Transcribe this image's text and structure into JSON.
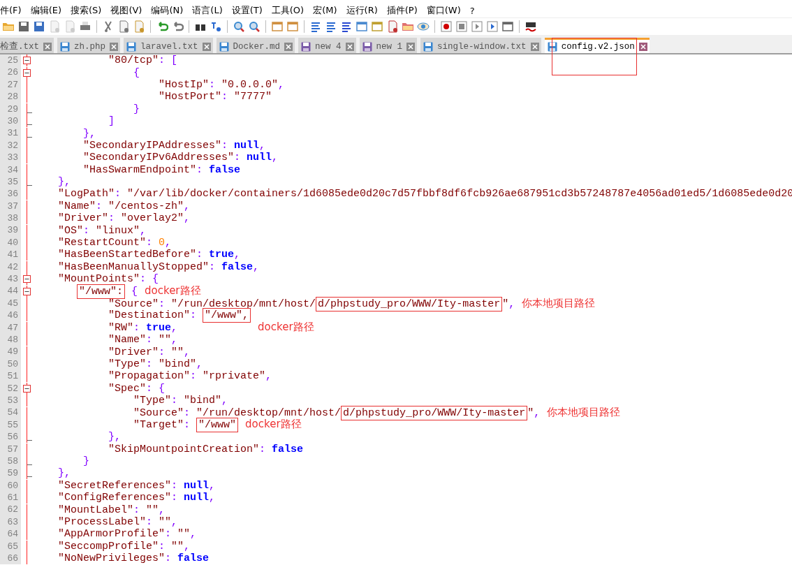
{
  "menu": [
    "件(F)",
    "编辑(E)",
    "搜索(S)",
    "视图(V)",
    "编码(N)",
    "语言(L)",
    "设置(T)",
    "工具(O)",
    "宏(M)",
    "运行(R)",
    "插件(P)",
    "窗口(W)",
    "?"
  ],
  "tabs": [
    {
      "label": "检查.txt",
      "selected": false,
      "annotated": false
    },
    {
      "label": "zh.php",
      "selected": false,
      "modified": false,
      "annotated": false
    },
    {
      "label": "laravel.txt",
      "selected": false,
      "modified": false,
      "annotated": false
    },
    {
      "label": "Docker.md",
      "selected": false,
      "modified": false,
      "annotated": false
    },
    {
      "label": "new 4",
      "selected": false,
      "modified": true,
      "annotated": false
    },
    {
      "label": "new 1",
      "selected": false,
      "modified": true,
      "annotated": false
    },
    {
      "label": "single-window.txt",
      "selected": false,
      "modified": false,
      "annotated": false
    },
    {
      "label": "config.v2.json",
      "selected": true,
      "modified": false,
      "annotated": true
    }
  ],
  "lines": [
    {
      "number": "25",
      "foldable": true,
      "block_end": false,
      "tokens": [
        {
          "kind": "str",
          "text": "            \"80/tcp\""
        },
        {
          "kind": "op",
          "text": ": ["
        }
      ]
    },
    {
      "number": "26",
      "foldable": true,
      "block_end": false,
      "tokens": [
        {
          "kind": "op",
          "text": "                {"
        }
      ]
    },
    {
      "number": "27",
      "foldable": false,
      "block_end": false,
      "tokens": [
        {
          "kind": "str",
          "text": "                    \"HostIp\""
        },
        {
          "kind": "op",
          "text": ": "
        },
        {
          "kind": "str",
          "text": "\"0.0.0.0\""
        },
        {
          "kind": "op",
          "text": ","
        }
      ]
    },
    {
      "number": "28",
      "foldable": false,
      "block_end": false,
      "tokens": [
        {
          "kind": "str",
          "text": "                    \"HostPort\""
        },
        {
          "kind": "op",
          "text": ": "
        },
        {
          "kind": "str",
          "text": "\"7777\""
        }
      ]
    },
    {
      "number": "29",
      "foldable": false,
      "block_end": true,
      "tokens": [
        {
          "kind": "op",
          "text": "                }"
        }
      ]
    },
    {
      "number": "30",
      "foldable": false,
      "block_end": true,
      "tokens": [
        {
          "kind": "op",
          "text": "            ]"
        }
      ]
    },
    {
      "number": "31",
      "foldable": false,
      "block_end": true,
      "tokens": [
        {
          "kind": "op",
          "text": "        },"
        }
      ]
    },
    {
      "number": "32",
      "foldable": false,
      "block_end": false,
      "tokens": [
        {
          "kind": "str",
          "text": "        \"SecondaryIPAddresses\""
        },
        {
          "kind": "op",
          "text": ": "
        },
        {
          "kind": "kw",
          "text": "null"
        },
        {
          "kind": "op",
          "text": ","
        }
      ]
    },
    {
      "number": "33",
      "foldable": false,
      "block_end": false,
      "tokens": [
        {
          "kind": "str",
          "text": "        \"SecondaryIPv6Addresses\""
        },
        {
          "kind": "op",
          "text": ": "
        },
        {
          "kind": "kw",
          "text": "null"
        },
        {
          "kind": "op",
          "text": ","
        }
      ]
    },
    {
      "number": "34",
      "foldable": false,
      "block_end": false,
      "tokens": [
        {
          "kind": "str",
          "text": "        \"HasSwarmEndpoint\""
        },
        {
          "kind": "op",
          "text": ": "
        },
        {
          "kind": "kw",
          "text": "false"
        }
      ]
    },
    {
      "number": "35",
      "foldable": false,
      "block_end": true,
      "tokens": [
        {
          "kind": "op",
          "text": "    },"
        }
      ]
    },
    {
      "number": "36",
      "foldable": false,
      "block_end": false,
      "tokens": [
        {
          "kind": "str",
          "text": "    \"LogPath\""
        },
        {
          "kind": "op",
          "text": ": "
        },
        {
          "kind": "str",
          "text": "\"/var/lib/docker/containers/1d6085ede0d20c7d57fbbf8df6fcb926ae687951cd3b57248787e4056ad01ed5/1d6085ede0d20"
        }
      ]
    },
    {
      "number": "37",
      "foldable": false,
      "block_end": false,
      "tokens": [
        {
          "kind": "str",
          "text": "    \"Name\""
        },
        {
          "kind": "op",
          "text": ": "
        },
        {
          "kind": "str",
          "text": "\"/centos-zh\""
        },
        {
          "kind": "op",
          "text": ","
        }
      ]
    },
    {
      "number": "38",
      "foldable": false,
      "block_end": false,
      "tokens": [
        {
          "kind": "str",
          "text": "    \"Driver\""
        },
        {
          "kind": "op",
          "text": ": "
        },
        {
          "kind": "str",
          "text": "\"overlay2\""
        },
        {
          "kind": "op",
          "text": ","
        }
      ]
    },
    {
      "number": "39",
      "foldable": false,
      "block_end": false,
      "tokens": [
        {
          "kind": "str",
          "text": "    \"OS\""
        },
        {
          "kind": "op",
          "text": ": "
        },
        {
          "kind": "str",
          "text": "\"linux\""
        },
        {
          "kind": "op",
          "text": ","
        }
      ]
    },
    {
      "number": "40",
      "foldable": false,
      "block_end": false,
      "tokens": [
        {
          "kind": "str",
          "text": "    \"RestartCount\""
        },
        {
          "kind": "op",
          "text": ": "
        },
        {
          "kind": "num",
          "text": "0"
        },
        {
          "kind": "op",
          "text": ","
        }
      ]
    },
    {
      "number": "41",
      "foldable": false,
      "block_end": false,
      "tokens": [
        {
          "kind": "str",
          "text": "    \"HasBeenStartedBefore\""
        },
        {
          "kind": "op",
          "text": ": "
        },
        {
          "kind": "kw",
          "text": "true"
        },
        {
          "kind": "op",
          "text": ","
        }
      ]
    },
    {
      "number": "42",
      "foldable": false,
      "block_end": false,
      "tokens": [
        {
          "kind": "str",
          "text": "    \"HasBeenManuallyStopped\""
        },
        {
          "kind": "op",
          "text": ": "
        },
        {
          "kind": "kw",
          "text": "false"
        },
        {
          "kind": "op",
          "text": ","
        }
      ]
    },
    {
      "number": "43",
      "foldable": true,
      "block_end": false,
      "tokens": [
        {
          "kind": "str",
          "text": "    \"MountPoints\""
        },
        {
          "kind": "op",
          "text": ": {"
        }
      ]
    },
    {
      "number": "44",
      "foldable": true,
      "block_end": false,
      "tokens": [
        {
          "kind": "indented-boxed",
          "text": "\"/www\":"
        },
        {
          "kind": "op",
          "text": " {"
        },
        {
          "kind": "note",
          "text": "docker路径"
        }
      ]
    },
    {
      "number": "45",
      "foldable": false,
      "block_end": false,
      "tokens": [
        {
          "kind": "str",
          "text": "            \"Source\""
        },
        {
          "kind": "op",
          "text": ": "
        },
        {
          "kind": "str",
          "text": "\"/run/desktop/mnt/host/"
        },
        {
          "kind": "boxed",
          "text": "d/phpstudy_pro/WWW/Ity-master"
        },
        {
          "kind": "str",
          "text": "\""
        },
        {
          "kind": "op",
          "text": ","
        },
        {
          "kind": "note",
          "text": "你本地项目路径"
        }
      ]
    },
    {
      "number": "46",
      "foldable": false,
      "block_end": false,
      "tokens": [
        {
          "kind": "str",
          "text": "            \"Destination\""
        },
        {
          "kind": "op",
          "text": ": "
        },
        {
          "kind": "boxed",
          "text": "\"/www\","
        }
      ]
    },
    {
      "number": "47",
      "foldable": false,
      "block_end": false,
      "tokens": [
        {
          "kind": "str",
          "text": "            \"RW\""
        },
        {
          "kind": "op",
          "text": ": "
        },
        {
          "kind": "kw",
          "text": "true"
        },
        {
          "kind": "op",
          "text": ","
        },
        {
          "kind": "far-note",
          "text": "docker路径"
        }
      ]
    },
    {
      "number": "48",
      "foldable": false,
      "block_end": false,
      "tokens": [
        {
          "kind": "str",
          "text": "            \"Name\""
        },
        {
          "kind": "op",
          "text": ": "
        },
        {
          "kind": "str",
          "text": "\"\""
        },
        {
          "kind": "op",
          "text": ","
        }
      ]
    },
    {
      "number": "49",
      "foldable": false,
      "block_end": false,
      "tokens": [
        {
          "kind": "str",
          "text": "            \"Driver\""
        },
        {
          "kind": "op",
          "text": ": "
        },
        {
          "kind": "str",
          "text": "\"\""
        },
        {
          "kind": "op",
          "text": ","
        }
      ]
    },
    {
      "number": "50",
      "foldable": false,
      "block_end": false,
      "tokens": [
        {
          "kind": "str",
          "text": "            \"Type\""
        },
        {
          "kind": "op",
          "text": ": "
        },
        {
          "kind": "str",
          "text": "\"bind\""
        },
        {
          "kind": "op",
          "text": ","
        }
      ]
    },
    {
      "number": "51",
      "foldable": false,
      "block_end": false,
      "tokens": [
        {
          "kind": "str",
          "text": "            \"Propagation\""
        },
        {
          "kind": "op",
          "text": ": "
        },
        {
          "kind": "str",
          "text": "\"rprivate\""
        },
        {
          "kind": "op",
          "text": ","
        }
      ]
    },
    {
      "number": "52",
      "foldable": true,
      "block_end": false,
      "tokens": [
        {
          "kind": "str",
          "text": "            \"Spec\""
        },
        {
          "kind": "op",
          "text": ": {"
        }
      ]
    },
    {
      "number": "53",
      "foldable": false,
      "block_end": false,
      "tokens": [
        {
          "kind": "str",
          "text": "                \"Type\""
        },
        {
          "kind": "op",
          "text": ": "
        },
        {
          "kind": "str",
          "text": "\"bind\""
        },
        {
          "kind": "op",
          "text": ","
        }
      ]
    },
    {
      "number": "54",
      "foldable": false,
      "block_end": false,
      "tokens": [
        {
          "kind": "str",
          "text": "                \"Source\""
        },
        {
          "kind": "op",
          "text": ": "
        },
        {
          "kind": "str",
          "text": "\"/run/desktop/mnt/host/"
        },
        {
          "kind": "boxed",
          "text": "d/phpstudy_pro/WWW/Ity-master"
        },
        {
          "kind": "str",
          "text": "\""
        },
        {
          "kind": "op",
          "text": ","
        },
        {
          "kind": "note",
          "text": "你本地项目路径"
        }
      ]
    },
    {
      "number": "55",
      "foldable": false,
      "block_end": false,
      "tokens": [
        {
          "kind": "str",
          "text": "                \"Target\""
        },
        {
          "kind": "op",
          "text": ": "
        },
        {
          "kind": "boxed",
          "text": "\"/www\""
        },
        {
          "kind": "note",
          "text": "docker路径"
        }
      ]
    },
    {
      "number": "56",
      "foldable": false,
      "block_end": true,
      "tokens": [
        {
          "kind": "op",
          "text": "            },"
        }
      ]
    },
    {
      "number": "57",
      "foldable": false,
      "block_end": false,
      "tokens": [
        {
          "kind": "str",
          "text": "            \"SkipMountpointCreation\""
        },
        {
          "kind": "op",
          "text": ": "
        },
        {
          "kind": "kw",
          "text": "false"
        }
      ]
    },
    {
      "number": "58",
      "foldable": false,
      "block_end": true,
      "tokens": [
        {
          "kind": "op",
          "text": "        }"
        }
      ]
    },
    {
      "number": "59",
      "foldable": false,
      "block_end": true,
      "tokens": [
        {
          "kind": "op",
          "text": "    },"
        }
      ]
    },
    {
      "number": "60",
      "foldable": false,
      "block_end": false,
      "tokens": [
        {
          "kind": "str",
          "text": "    \"SecretReferences\""
        },
        {
          "kind": "op",
          "text": ": "
        },
        {
          "kind": "kw",
          "text": "null"
        },
        {
          "kind": "op",
          "text": ","
        }
      ]
    },
    {
      "number": "61",
      "foldable": false,
      "block_end": false,
      "tokens": [
        {
          "kind": "str",
          "text": "    \"ConfigReferences\""
        },
        {
          "kind": "op",
          "text": ": "
        },
        {
          "kind": "kw",
          "text": "null"
        },
        {
          "kind": "op",
          "text": ","
        }
      ]
    },
    {
      "number": "62",
      "foldable": false,
      "block_end": false,
      "tokens": [
        {
          "kind": "str",
          "text": "    \"MountLabel\""
        },
        {
          "kind": "op",
          "text": ": "
        },
        {
          "kind": "str",
          "text": "\"\""
        },
        {
          "kind": "op",
          "text": ","
        }
      ]
    },
    {
      "number": "63",
      "foldable": false,
      "block_end": false,
      "tokens": [
        {
          "kind": "str",
          "text": "    \"ProcessLabel\""
        },
        {
          "kind": "op",
          "text": ": "
        },
        {
          "kind": "str",
          "text": "\"\""
        },
        {
          "kind": "op",
          "text": ","
        }
      ]
    },
    {
      "number": "64",
      "foldable": false,
      "block_end": false,
      "tokens": [
        {
          "kind": "str",
          "text": "    \"AppArmorProfile\""
        },
        {
          "kind": "op",
          "text": ": "
        },
        {
          "kind": "str",
          "text": "\"\""
        },
        {
          "kind": "op",
          "text": ","
        }
      ]
    },
    {
      "number": "65",
      "foldable": false,
      "block_end": false,
      "tokens": [
        {
          "kind": "str",
          "text": "    \"SeccompProfile\""
        },
        {
          "kind": "op",
          "text": ": "
        },
        {
          "kind": "str",
          "text": "\"\""
        },
        {
          "kind": "op",
          "text": ","
        }
      ]
    },
    {
      "number": "66",
      "foldable": false,
      "block_end": false,
      "tokens": [
        {
          "kind": "str",
          "text": "    \"NoNewPrivileges\""
        },
        {
          "kind": "op",
          "text": ": "
        },
        {
          "kind": "kw",
          "text": "false"
        }
      ]
    }
  ]
}
